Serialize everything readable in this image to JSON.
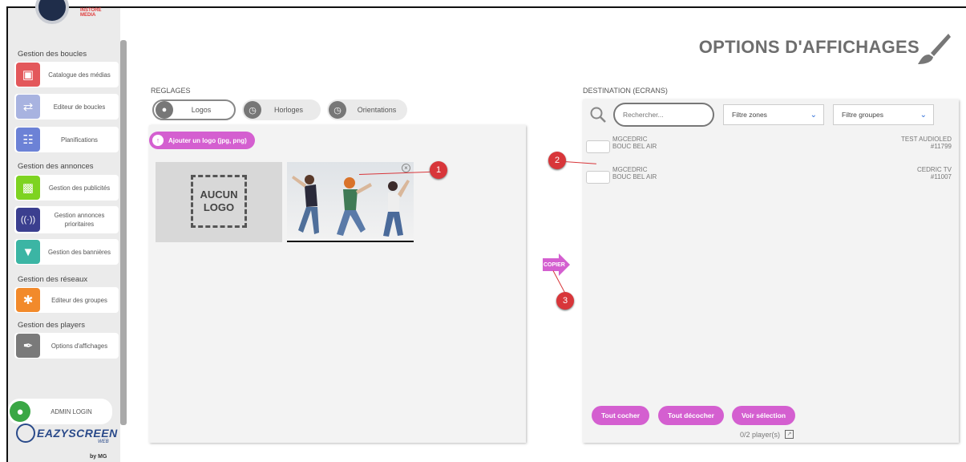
{
  "sidebar": {
    "brand_top": "INSTORE MEDIA",
    "sections": [
      {
        "title": "Gestion des boucles"
      },
      {
        "title": "Gestion des annonces"
      },
      {
        "title": "Gestion des réseaux"
      },
      {
        "title": "Gestion des players"
      }
    ],
    "items": [
      {
        "label": "Catalogue des médias",
        "icon": "media-catalog-icon",
        "color": "#e3585b"
      },
      {
        "label": "Editeur de boucles",
        "icon": "loop-editor-icon",
        "color": "#a8b3e0"
      },
      {
        "label": "Planifications",
        "icon": "calendar-icon",
        "color": "#6c82d6"
      },
      {
        "label": "Gestion des publicités",
        "icon": "ads-icon",
        "color": "#7ed321"
      },
      {
        "label": "Gestion annonces prioritaires",
        "icon": "broadcast-icon",
        "color": "#3b3f8f"
      },
      {
        "label": "Gestion des bannières",
        "icon": "banner-icon",
        "color": "#3bb5a4"
      },
      {
        "label": "Editeur des groupes",
        "icon": "groups-icon",
        "color": "#f28a2b"
      },
      {
        "label": "Options d'affichages",
        "icon": "brush-icon",
        "color": "#7a7a7a"
      }
    ],
    "admin_label": "ADMIN LOGIN",
    "brand_name": "EAZYSCREEN",
    "brand_sub": "WEB",
    "brand_by": "by MG"
  },
  "header": {
    "title": "OPTIONS D'AFFICHAGES"
  },
  "reglages": {
    "label": "REGLAGES",
    "tabs": [
      {
        "label": "Logos",
        "active": true
      },
      {
        "label": "Horloges",
        "active": false
      },
      {
        "label": "Orientations",
        "active": false
      }
    ],
    "add_button": "Ajouter un logo (jpg, png)",
    "no_logo_line1": "AUCUN",
    "no_logo_line2": "LOGO"
  },
  "destination": {
    "label": "DESTINATION (ECRANS)",
    "search_placeholder": "Rechercher...",
    "filter_zones": "Filtre zones",
    "filter_groups": "Filtre groupes",
    "rows": [
      {
        "name1": "MGCEDRIC",
        "name2": "BOUC BEL AIR",
        "screen": "TEST AUDIOLED",
        "id": "#11799"
      },
      {
        "name1": "MGCEDRIC",
        "name2": "BOUC BEL AIR",
        "screen": "CEDRIC TV",
        "id": "#11007"
      }
    ],
    "btn_check_all": "Tout cocher",
    "btn_uncheck_all": "Tout décocher",
    "btn_view_selection": "Voir sélection",
    "count": "0/2 player(s)"
  },
  "copy_button": "COPIER",
  "callouts": [
    "1",
    "2",
    "3"
  ]
}
